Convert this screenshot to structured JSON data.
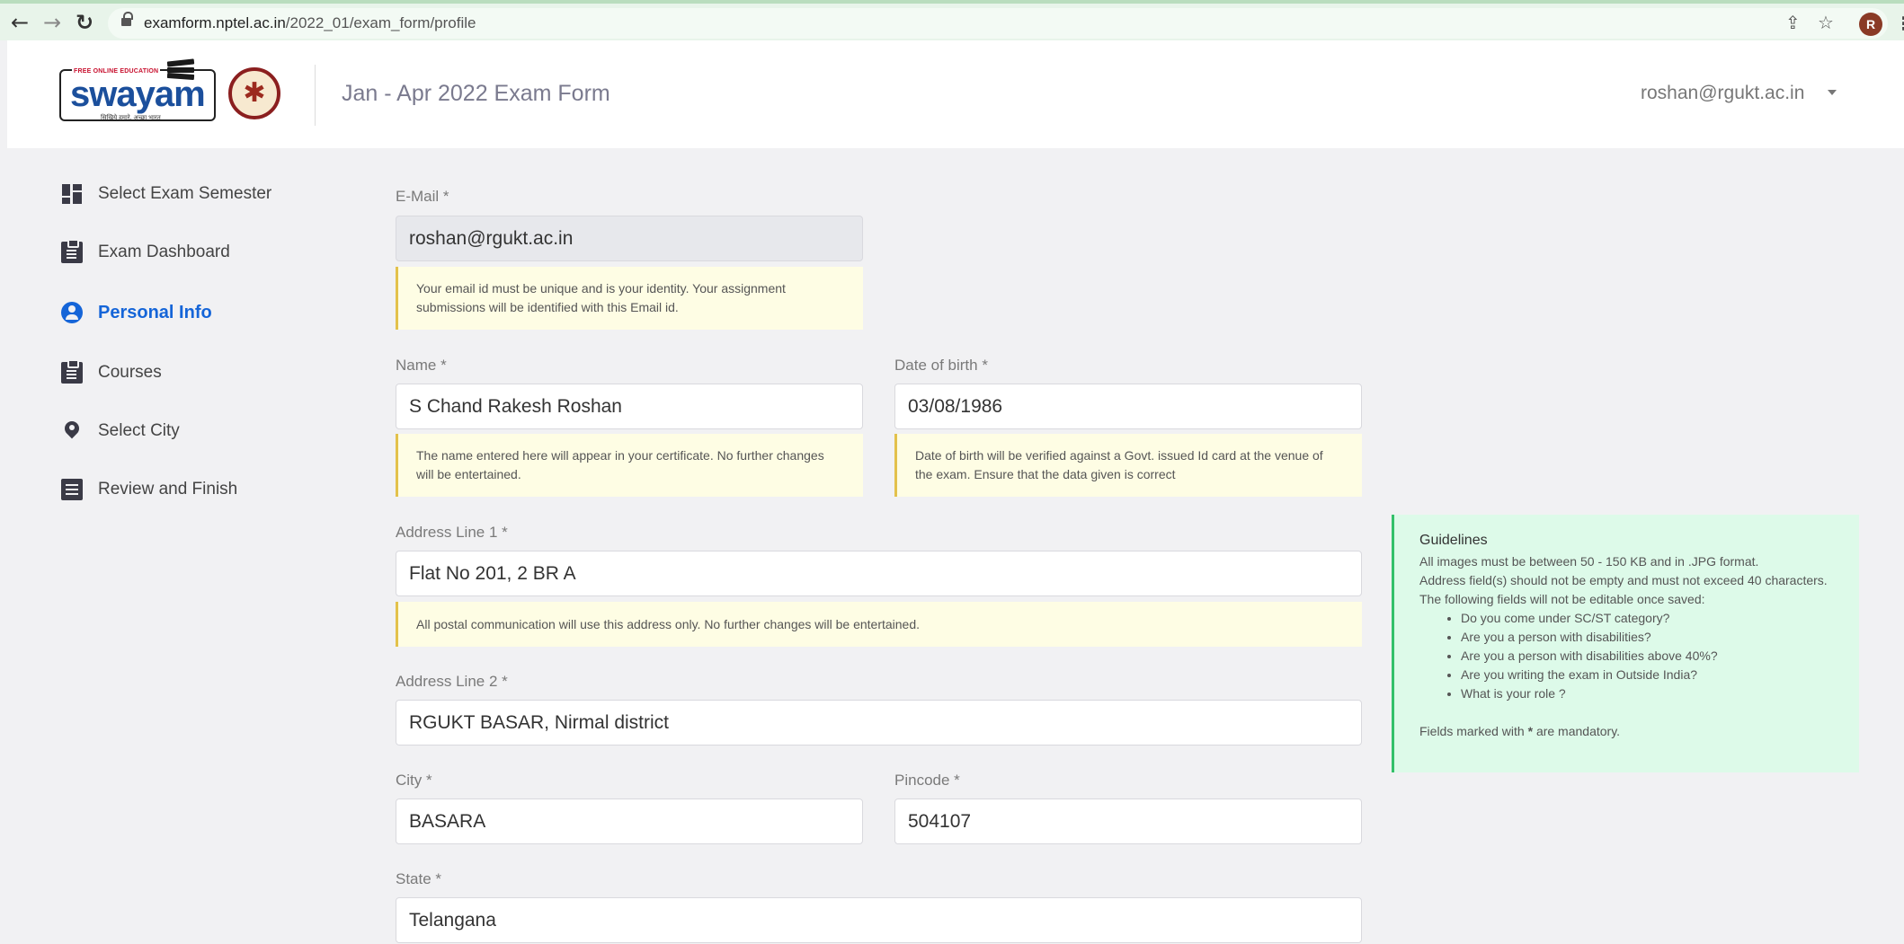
{
  "browser": {
    "url_host": "examform.nptel.ac.in",
    "url_path": "/2022_01/exam_form/profile",
    "profile_initial": "R"
  },
  "header": {
    "logo_word": "swayam",
    "logo_tagline": "FREE ONLINE EDUCATION",
    "logo_subtitle": "सिखिये हमारे, अच्छा भारत",
    "title": "Jan - Apr 2022 Exam Form",
    "user_email": "roshan@rgukt.ac.in"
  },
  "sidebar": {
    "items": [
      {
        "label": "Select Exam Semester",
        "icon": "dashboard-icon"
      },
      {
        "label": "Exam Dashboard",
        "icon": "clipboard-icon"
      },
      {
        "label": "Personal Info",
        "icon": "user-circle-icon",
        "active": true
      },
      {
        "label": "Courses",
        "icon": "clipboard-icon"
      },
      {
        "label": "Select City",
        "icon": "map-pin-icon"
      },
      {
        "label": "Review and Finish",
        "icon": "list-icon"
      }
    ]
  },
  "form": {
    "email": {
      "label": "E-Mail *",
      "value": "roshan@rgukt.ac.in",
      "note": "Your email id must be unique and is your identity. Your assignment submissions will be identified with this Email id."
    },
    "name": {
      "label": "Name *",
      "value": "S Chand Rakesh Roshan",
      "note": "The name entered here will appear in your certificate. No further changes will be entertained."
    },
    "dob": {
      "label": "Date of birth *",
      "value": "03/08/1986",
      "note": "Date of birth will be verified against a Govt. issued Id card at the venue of the exam. Ensure that the data given is correct"
    },
    "address1": {
      "label": "Address Line 1 *",
      "value": "Flat No 201, 2 BR A",
      "note": "All postal communication will use this address only. No further changes will be entertained."
    },
    "address2": {
      "label": "Address Line 2 *",
      "value": "RGUKT BASAR, Nirmal district"
    },
    "city": {
      "label": "City *",
      "value": "BASARA"
    },
    "pincode": {
      "label": "Pincode *",
      "value": "504107"
    },
    "state": {
      "label": "State *",
      "value": "Telangana"
    }
  },
  "guidelines": {
    "title": "Guidelines",
    "line1": "All images must be between 50 - 150 KB and in .JPG format.",
    "line2": "Address field(s) should not be empty and must not exceed 40 characters.",
    "line3": "The following fields will not be editable once saved:",
    "items": [
      "Do you come under SC/ST category?",
      "Are you a person with disabilities?",
      "Are you a person with disabilities above 40%?",
      "Are you writing the exam in Outside India?",
      "What is your role ?"
    ],
    "footer_prefix": "Fields marked with",
    "footer_mark": "*",
    "footer_suffix": "are mandatory."
  }
}
